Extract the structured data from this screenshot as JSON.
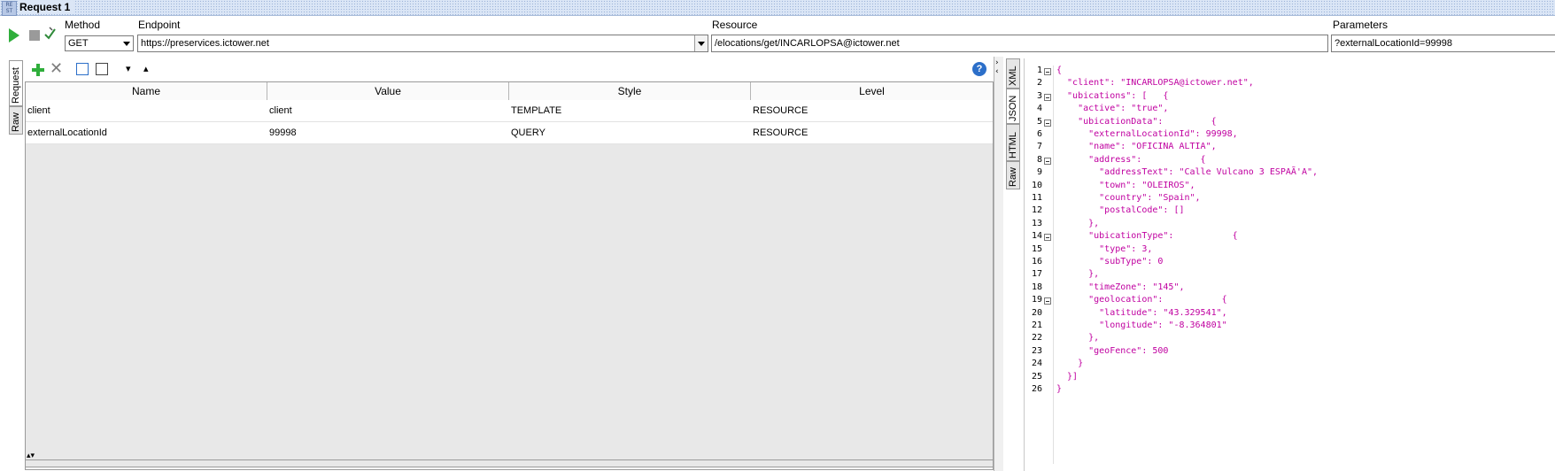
{
  "window": {
    "title": "Request 1",
    "icon_text": "RE ST"
  },
  "toolbar": {
    "method_label": "Method",
    "method_value": "GET",
    "endpoint_label": "Endpoint",
    "endpoint_value": "https://preservices.ictower.net",
    "resource_label": "Resource",
    "resource_value": "/elocations/get/INCARLOPSA@ictower.net",
    "parameters_label": "Parameters",
    "parameters_value": "?externalLocationId=99998"
  },
  "left_tabs": [
    "Request",
    "Raw"
  ],
  "right_tabs": [
    "XML",
    "JSON",
    "HTML",
    "Raw"
  ],
  "params_table": {
    "columns": [
      "Name",
      "Value",
      "Style",
      "Level"
    ],
    "rows": [
      [
        "client",
        "client",
        "TEMPLATE",
        "RESOURCE"
      ],
      [
        "externalLocationId",
        "99998",
        "QUERY",
        "RESOURCE"
      ]
    ]
  },
  "help_label": "?",
  "json_lines": [
    "{",
    "  \"client\": \"INCARLOPSA@ictower.net\",",
    "  \"ubications\": [   {",
    "    \"active\": \"true\",",
    "    \"ubicationData\":         {",
    "      \"externalLocationId\": 99998,",
    "      \"name\": \"OFICINA ALTIA\",",
    "      \"address\":           {",
    "        \"addressText\": \"Calle Vulcano 3 ESPAÃ'A\",",
    "        \"town\": \"OLEIROS\",",
    "        \"country\": \"Spain\",",
    "        \"postalCode\": []",
    "      },",
    "      \"ubicationType\":           {",
    "        \"type\": 3,",
    "        \"subType\": 0",
    "      },",
    "      \"timeZone\": \"145\",",
    "      \"geolocation\":           {",
    "        \"latitude\": \"43.329541\",",
    "        \"longitude\": \"-8.364801\"",
    "      },",
    "      \"geoFence\": 500",
    "    }",
    "  }]",
    "}"
  ],
  "fold_lines": [
    1,
    3,
    5,
    8,
    14,
    19
  ]
}
